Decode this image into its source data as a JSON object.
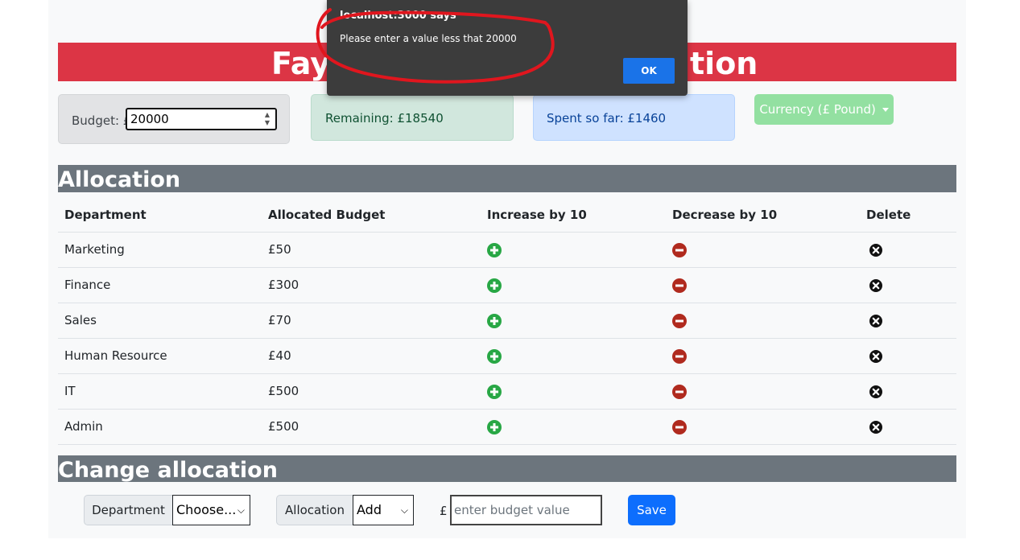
{
  "app": {
    "title_visible": "Fay'"
  },
  "stats": {
    "budget_label": "Budget: £",
    "budget_value": "20000",
    "remaining": "Remaining: £18540",
    "spent": "Spent so far: £1460",
    "currency_button": "Currency (£ Pound)"
  },
  "allocation": {
    "heading": "Allocation",
    "columns": [
      "Department",
      "Allocated Budget",
      "Increase by 10",
      "Decrease by 10",
      "Delete"
    ],
    "rows": [
      {
        "department": "Marketing",
        "budget": "£50"
      },
      {
        "department": "Finance",
        "budget": "£300"
      },
      {
        "department": "Sales",
        "budget": "£70"
      },
      {
        "department": "Human Resource",
        "budget": "£40"
      },
      {
        "department": "IT",
        "budget": "£500"
      },
      {
        "department": "Admin",
        "budget": "£500"
      }
    ]
  },
  "change": {
    "heading": "Change allocation",
    "department_label": "Department",
    "department_select": "Choose...",
    "allocation_label": "Allocation",
    "allocation_select": "Add",
    "currency_symbol": "£",
    "value_placeholder": "enter budget value",
    "save_label": "Save"
  },
  "alert": {
    "title": "localhost:3000 says",
    "message": "Please enter a value less that 20000",
    "ok_label": "OK"
  },
  "colors": {
    "banner": "#dc3545",
    "section_header": "#6c757d",
    "increase_icon": "#28a745",
    "decrease_icon": "#b02a1e",
    "delete_icon": "#111111",
    "save_button": "#0d6efd",
    "annotation": "#e0161e"
  },
  "icons": {
    "increase": "plus-circle-icon",
    "decrease": "minus-circle-icon",
    "delete": "x-circle-icon"
  }
}
